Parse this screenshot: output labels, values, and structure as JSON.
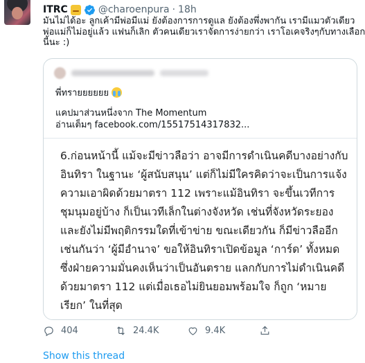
{
  "tweet": {
    "author_name": "ITRC",
    "handle": "@charoenpura",
    "separator": "·",
    "time": "18h",
    "text_lines": [
      "มันไม่ได้อะ ลูกเค้ามีพ่อมีแม่ ยังต้องการการดูแล ยังต้องพึ่งพากัน เรามีแมวตัวเดียว",
      "พ่อแม่ก็ไม่อยู่แล้ว แฟนก็เลิก ตัวคนเดียวเราจัดการง่ายกว่า เราโอเคจริงๆกับทางเลือก",
      "นี้นะ :)"
    ]
  },
  "quoted": {
    "text": "พี่ทรายยยยยย",
    "source_line": "แคปมาส่วนหนึ่งจาก The Momentum",
    "link_line": "อ่านเต็มๆ facebook.com/15517514317832...",
    "image_text_lines": [
      "6.ก่อนหน้านี้ แม้จะมีข่าวลือว่า อาจมีการดำเนินคดีบางอย่างกับ",
      "อินทิรา ในฐานะ ‘ผู้สนับสนุน’ แต่ก็ไม่มีใครคิดว่าจะเป็นการแจ้ง",
      "ความเอาผิดด้วยมาตรา 112 เพราะแม้อินทิรา จะขึ้นเวทีการ",
      "ชุมนุมอยู่บ้าง ก็เป็นเวทีเล็กในต่างจังหวัด เช่นที่จังหวัดระยอง",
      "และยังไม่มีพฤติกรรมใดที่เข้าข่าย ขณะเดียวกัน ก็มีข่าวลืออีก",
      "เช่นกันว่า ‘ผู้มีอำนาจ’ ขอให้อินทิราเปิดข้อมูล ‘การ์ด’ ทั้งหมด",
      "ซึ่งฝ่ายความมั่นคงเห็นว่าเป็นอันตราย แลกกับการไม่ดำเนินคดี",
      "ด้วยมาตรา 112 แต่เมื่อเธอไม่ยินยอมพร้อมใจ ก็ถูก ‘หมาย",
      "เรียก’ ในที่สุด"
    ]
  },
  "actions": {
    "reply_count": "404",
    "retweet_count": "24.4K",
    "like_count": "9.4K"
  },
  "show_thread_label": "Show this thread",
  "colors": {
    "link": "#1d9bf0",
    "muted": "#536471",
    "verified": "#1d9bf0"
  }
}
